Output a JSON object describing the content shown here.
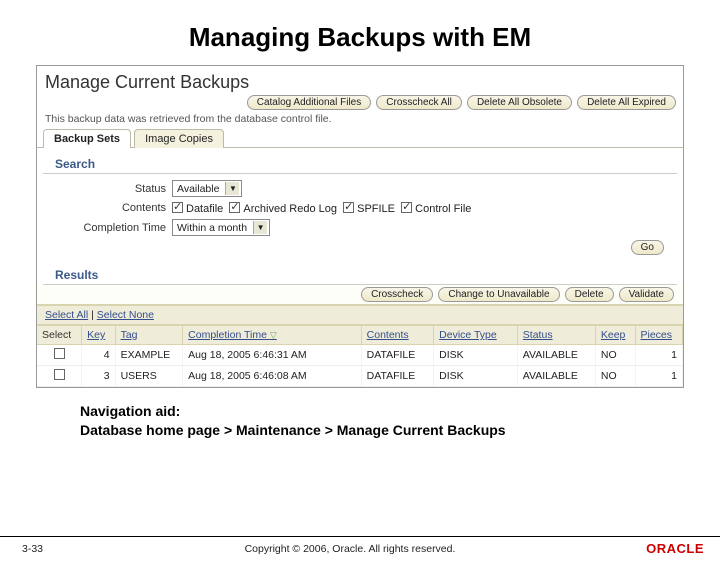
{
  "slide": {
    "title": "Managing Backups with EM",
    "nav_note_label": "Navigation aid:",
    "nav_note_path": "Database home page > Maintenance > Manage Current Backups",
    "page_number": "3-33",
    "copyright": "Copyright © 2006, Oracle. All rights reserved.",
    "logo": "ORACLE"
  },
  "page": {
    "heading": "Manage Current Backups",
    "info": "This backup data was retrieved from the database control file.",
    "top_buttons": {
      "catalog": "Catalog Additional Files",
      "crosscheck": "Crosscheck All",
      "delete_obsolete": "Delete All Obsolete",
      "delete_expired": "Delete All Expired"
    }
  },
  "tabs": {
    "backup_sets": "Backup Sets",
    "image_copies": "Image Copies"
  },
  "search": {
    "header": "Search",
    "labels": {
      "status": "Status",
      "contents": "Contents",
      "completion": "Completion Time"
    },
    "status_value": "Available",
    "contents_opts": {
      "datafile": "Datafile",
      "arch": "Archived Redo Log",
      "spfile": "SPFILE",
      "ctl": "Control File"
    },
    "completion_value": "Within a month",
    "go": "Go"
  },
  "results": {
    "header": "Results",
    "buttons": {
      "crosscheck": "Crosscheck",
      "change": "Change to Unavailable",
      "delete": "Delete",
      "validate": "Validate"
    },
    "select_all": "Select All",
    "select_none": "Select None",
    "sep": " | ",
    "cols": {
      "select": "Select",
      "key": "Key",
      "tag": "Tag",
      "completion": "Completion Time",
      "sort": "▽",
      "contents": "Contents",
      "device": "Device Type",
      "status": "Status",
      "keep": "Keep",
      "pieces": "Pieces"
    },
    "rows": [
      {
        "key": "4",
        "tag": "EXAMPLE",
        "completion": "Aug 18, 2005 6:46:31 AM",
        "contents": "DATAFILE",
        "device": "DISK",
        "status": "AVAILABLE",
        "keep": "NO",
        "pieces": "1"
      },
      {
        "key": "3",
        "tag": "USERS",
        "completion": "Aug 18, 2005 6:46:08 AM",
        "contents": "DATAFILE",
        "device": "DISK",
        "status": "AVAILABLE",
        "keep": "NO",
        "pieces": "1"
      }
    ]
  }
}
